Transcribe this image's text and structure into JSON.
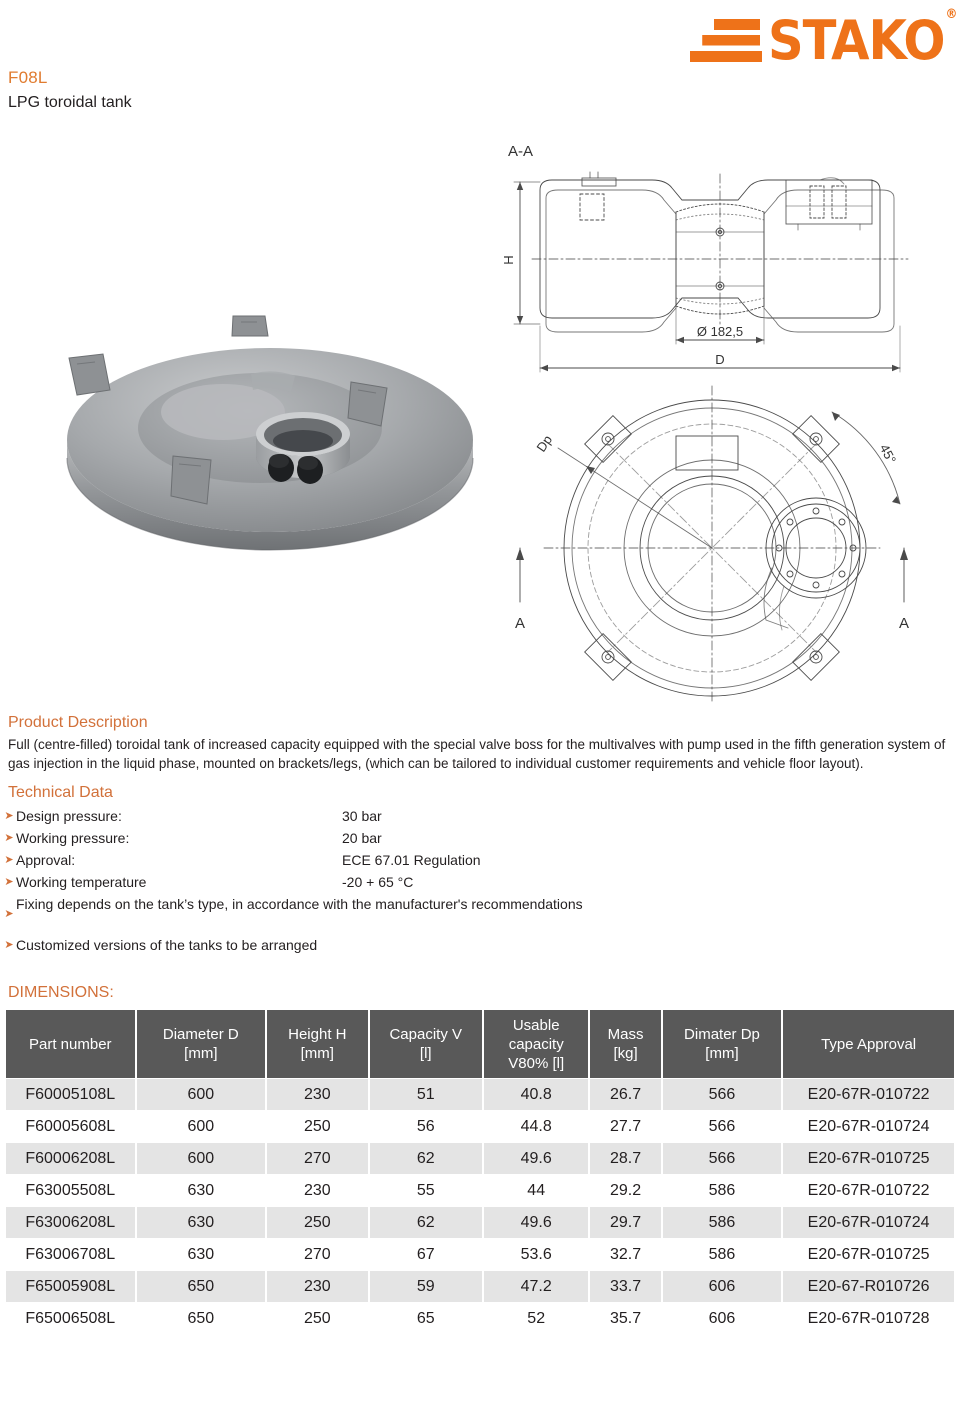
{
  "header": {
    "doc_code": "F08L",
    "doc_subtitle": "LPG toroidal tank",
    "logo_word": "STAKO",
    "logo_registered": "®",
    "accent_color": "#EE7219",
    "heading_color": "#D2713A"
  },
  "drawing": {
    "section_label": "A-A",
    "height_label": "H",
    "diameter_label": "D",
    "bore_label": "Ø 182,5",
    "dp_label": "Dp",
    "angle_label": "45°",
    "section_mark_left": "A",
    "section_mark_right": "A"
  },
  "product_description": {
    "heading": "Product Description",
    "body": "Full (centre-filled) toroidal tank of increased capacity equipped with the special valve boss for the multivalves with pump used in the fifth generation system of gas injection in the liquid phase, mounted on brackets/legs, (which can be tailored to individual customer requirements and vehicle floor layout)."
  },
  "technical_data": {
    "heading": "Technical Data",
    "items": [
      {
        "label": "Design pressure:",
        "value": "30 bar"
      },
      {
        "label": "Working pressure:",
        "value": "20 bar"
      },
      {
        "label": "Approval:",
        "value": "ECE 67.01 Regulation"
      },
      {
        "label": "Working temperature",
        "value": "-20 + 65 °C"
      },
      {
        "label": "Fixing depends on the tank’s type, in accordance with the manufacturer's recommendations",
        "value": ""
      },
      {
        "label": "Customized versions of the tanks to be arranged",
        "value": ""
      }
    ]
  },
  "dimensions": {
    "heading": "DIMENSIONS:",
    "columns": [
      "Part number",
      "Diameter D\n[mm]",
      "Height H\n[mm]",
      "Capacity V\n[l]",
      "Usable\ncapacity\nV80% [l]",
      "Mass\n[kg]",
      "Dimater Dp\n[mm]",
      "Type Approval"
    ],
    "rows": [
      [
        "F60005108L",
        "600",
        "230",
        "51",
        "40.8",
        "26.7",
        "566",
        "E20-67R-010722"
      ],
      [
        "F60005608L",
        "600",
        "250",
        "56",
        "44.8",
        "27.7",
        "566",
        "E20-67R-010724"
      ],
      [
        "F60006208L",
        "600",
        "270",
        "62",
        "49.6",
        "28.7",
        "566",
        "E20-67R-010725"
      ],
      [
        "F63005508L",
        "630",
        "230",
        "55",
        "44",
        "29.2",
        "586",
        "E20-67R-010722"
      ],
      [
        "F63006208L",
        "630",
        "250",
        "62",
        "49.6",
        "29.7",
        "586",
        "E20-67R-010724"
      ],
      [
        "F63006708L",
        "630",
        "270",
        "67",
        "53.6",
        "32.7",
        "586",
        "E20-67R-010725"
      ],
      [
        "F65005908L",
        "650",
        "230",
        "59",
        "47.2",
        "33.7",
        "606",
        "E20-67-R010726"
      ],
      [
        "F65006508L",
        "650",
        "250",
        "65",
        "52",
        "35.7",
        "606",
        "E20-67R-010728"
      ]
    ]
  }
}
